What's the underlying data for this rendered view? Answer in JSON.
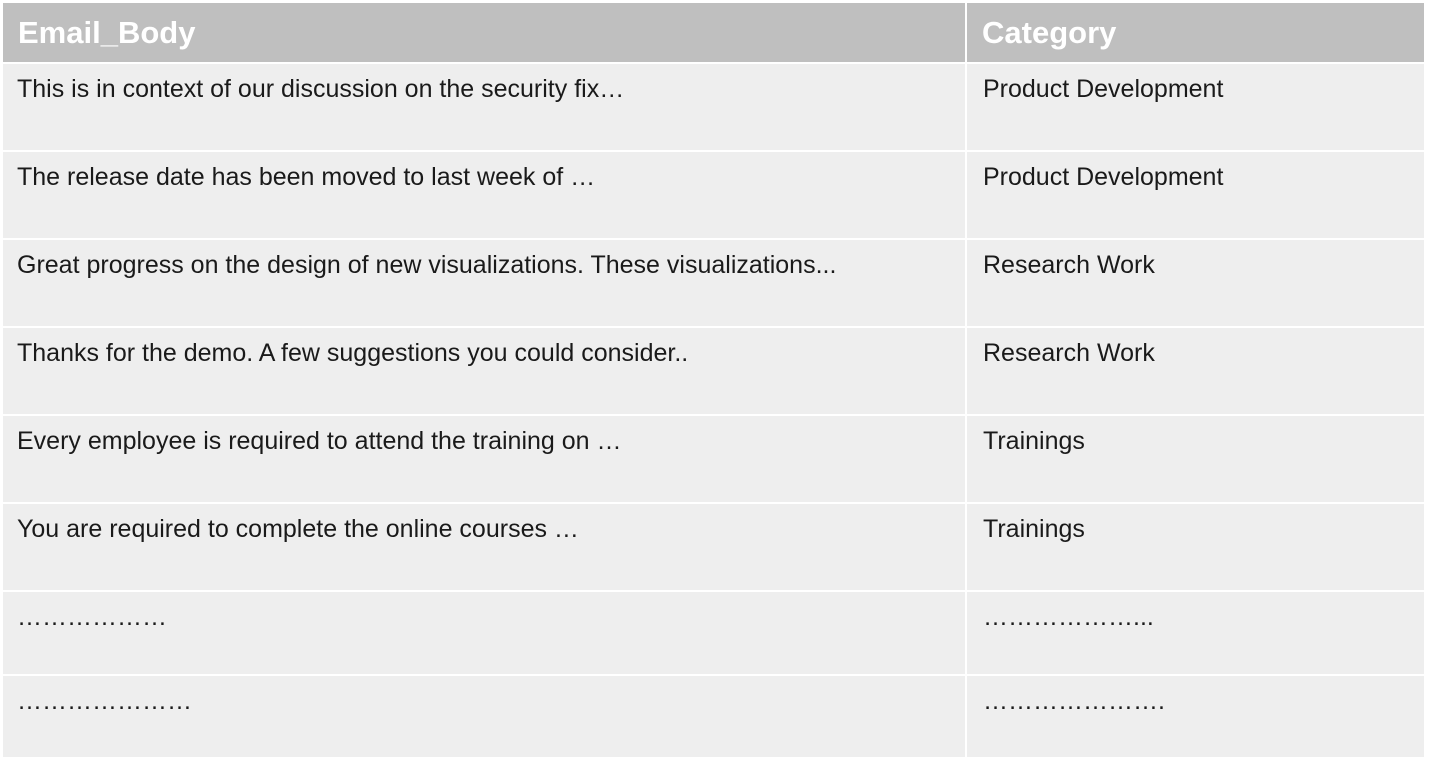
{
  "columns": [
    "Email_Body",
    "Category"
  ],
  "rows": [
    {
      "email_body": "This is in context of our discussion on the security fix…",
      "category": "Product Development"
    },
    {
      "email_body": "The release date has been moved to last week of …",
      "category": "Product Development"
    },
    {
      "email_body": "Great progress on the design of new visualizations.  These visualizations...",
      "category": "Research Work"
    },
    {
      "email_body": "Thanks for the demo. A few suggestions you could consider..",
      "category": "Research Work"
    },
    {
      "email_body": "Every employee is required to attend the training on …",
      "category": "Trainings"
    },
    {
      "email_body": "You are required to complete the online courses …",
      "category": "Trainings"
    },
    {
      "email_body": "………………",
      "category": "………………..."
    },
    {
      "email_body": "…………………",
      "category": "…………………."
    }
  ],
  "colors": {
    "header_bg": "#bfbfbf",
    "header_text": "#ffffff",
    "row_bg": "#eeeeee",
    "row_text": "#1a1a1a",
    "grid_line": "#ffffff"
  }
}
